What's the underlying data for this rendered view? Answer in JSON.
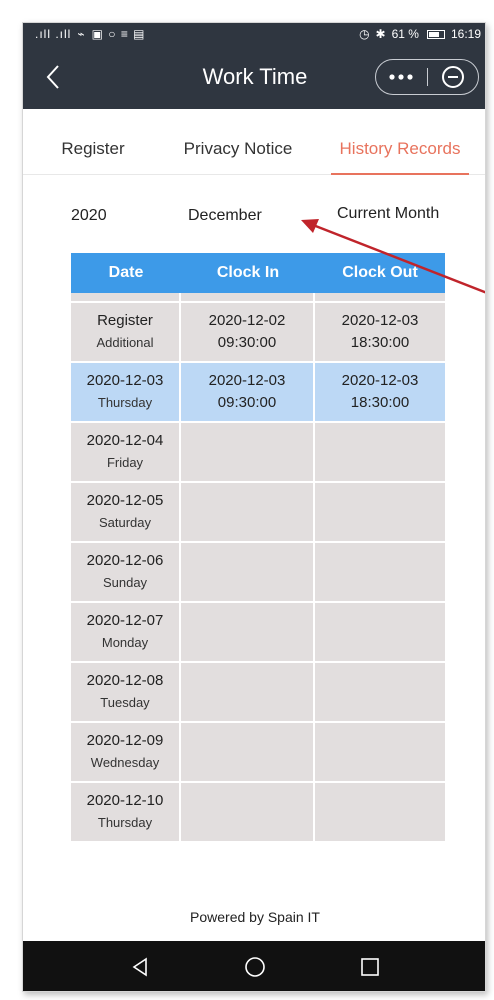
{
  "status": {
    "left_text": ".ıll .ıll",
    "battery": "61 %",
    "time": "16:19"
  },
  "titlebar": {
    "title": "Work Time"
  },
  "tabs": [
    {
      "label": "Register",
      "active": false
    },
    {
      "label": "Privacy Notice",
      "active": false
    },
    {
      "label": "History Records",
      "active": true
    }
  ],
  "selector": {
    "year": "2020",
    "month": "December",
    "current": "Current Month"
  },
  "table": {
    "headers": [
      "Date",
      "Clock In",
      "Clock Out"
    ],
    "rows": [
      {
        "date": "Register",
        "day": "Additional",
        "in_date": "2020-12-02",
        "in_time": "09:30:00",
        "out_date": "2020-12-03",
        "out_time": "18:30:00"
      },
      {
        "date": "2020-12-03",
        "day": "Thursday",
        "in_date": "2020-12-03",
        "in_time": "09:30:00",
        "out_date": "2020-12-03",
        "out_time": "18:30:00"
      },
      {
        "date": "2020-12-04",
        "day": "Friday",
        "in_date": "",
        "in_time": "",
        "out_date": "",
        "out_time": ""
      },
      {
        "date": "2020-12-05",
        "day": "Saturday",
        "in_date": "",
        "in_time": "",
        "out_date": "",
        "out_time": ""
      },
      {
        "date": "2020-12-06",
        "day": "Sunday",
        "in_date": "",
        "in_time": "",
        "out_date": "",
        "out_time": ""
      },
      {
        "date": "2020-12-07",
        "day": "Monday",
        "in_date": "",
        "in_time": "",
        "out_date": "",
        "out_time": ""
      },
      {
        "date": "2020-12-08",
        "day": "Tuesday",
        "in_date": "",
        "in_time": "",
        "out_date": "",
        "out_time": ""
      },
      {
        "date": "2020-12-09",
        "day": "Wednesday",
        "in_date": "",
        "in_time": "",
        "out_date": "",
        "out_time": ""
      },
      {
        "date": "2020-12-10",
        "day": "Thursday",
        "in_date": "",
        "in_time": "",
        "out_date": "",
        "out_time": ""
      }
    ]
  },
  "footer": {
    "text": "Powered by Spain IT"
  },
  "colors": {
    "header_bg": "#2f3640",
    "accent": "#e8735d",
    "table_header": "#3d9ae8",
    "highlight_row": "#bcd8f5",
    "cell_bg": "#e2dede",
    "annotation_arrow": "#c0242b"
  },
  "icons": {
    "back": "chevron-left-icon",
    "more": "more-dots-icon",
    "close": "circle-minus-icon",
    "nav_back": "triangle-back-icon",
    "nav_home": "circle-home-icon",
    "nav_recent": "square-recent-icon"
  }
}
